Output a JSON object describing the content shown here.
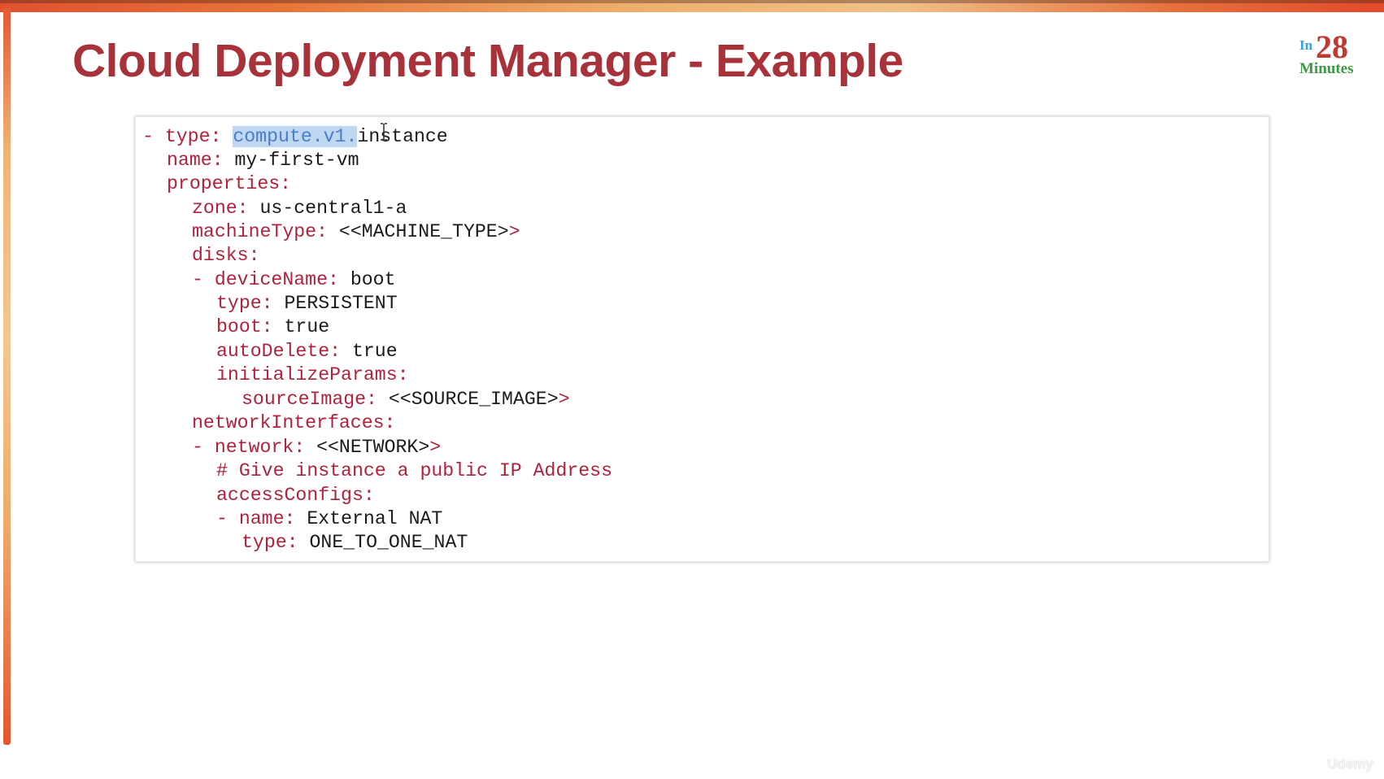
{
  "slide": {
    "title": "Cloud Deployment Manager - Example",
    "logo": {
      "prefix": "In",
      "number": "28",
      "suffix": "Minutes"
    },
    "watermark": "Udemy"
  },
  "code": {
    "lines": [
      {
        "dash": "- ",
        "key": "type:",
        "value": "",
        "selected": "compute.v1.",
        "rest": "instance"
      },
      {
        "key": "name:",
        "value": " my-first-vm"
      },
      {
        "key": "properties:",
        "value": ""
      },
      {
        "key": "zone:",
        "value": " us-central1-a"
      },
      {
        "key": "machineType:",
        "value": " <<MACHINE_TYPE>"
      },
      {
        "key": "disks:",
        "value": ""
      },
      {
        "dash": "- ",
        "key": "deviceName:",
        "value": " boot"
      },
      {
        "key": "type:",
        "value": " PERSISTENT"
      },
      {
        "key": "boot:",
        "value": " true"
      },
      {
        "key": "autoDelete:",
        "value": " true"
      },
      {
        "key": "initializeParams:",
        "value": ""
      },
      {
        "key": "sourceImage:",
        "value": " <<SOURCE_IMAGE>"
      },
      {
        "key": "networkInterfaces:",
        "value": ""
      },
      {
        "dash": "- ",
        "key": "network:",
        "value": " <<NETWORK>"
      },
      {
        "comment": "# Give instance a public IP Address"
      },
      {
        "key": "accessConfigs:",
        "value": ""
      },
      {
        "dash": "- ",
        "key": "name:",
        "value": " External NAT"
      },
      {
        "key": "type:",
        "value": " ONE_TO_ONE_NAT"
      }
    ],
    "trailing_gt": ">"
  },
  "colors": {
    "title": "#a8323a",
    "key": "#b0223c",
    "value": "#1a1a1a",
    "selection": "#c0d7f2"
  },
  "icons": {
    "cursor": "text-cursor-icon"
  }
}
